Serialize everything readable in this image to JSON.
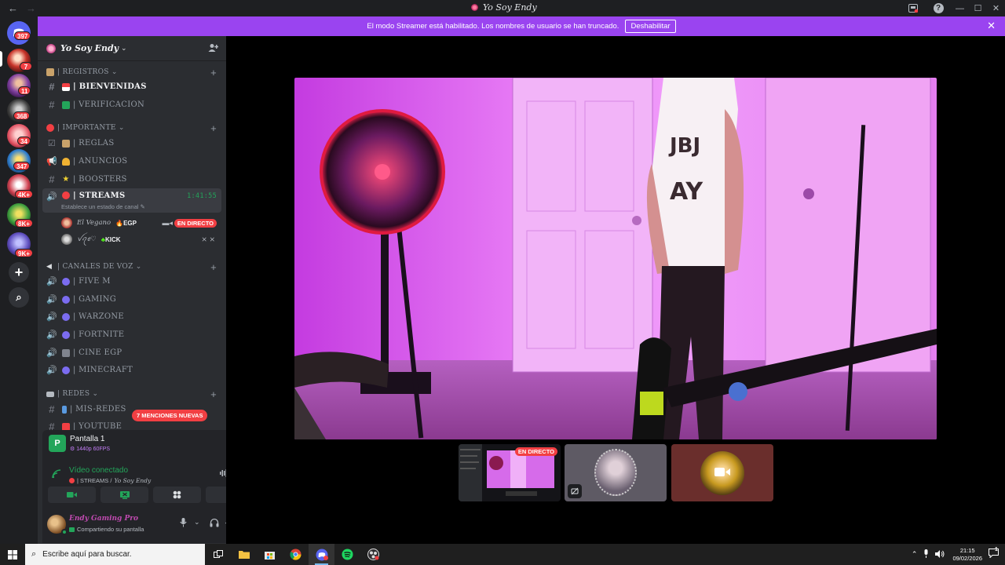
{
  "window": {
    "title": "Yo Soy Endy",
    "nav_back": "←",
    "nav_forward": "→",
    "win_minimize": "—",
    "win_maximize": "☐",
    "win_close": "✕"
  },
  "streamer_banner": {
    "text": "El modo Streamer está habilitado. Los nombres de usuario se han truncado.",
    "button": "Deshabilitar"
  },
  "rail": {
    "servers": [
      {
        "badge": "397"
      },
      {
        "badge": "7"
      },
      {
        "badge": "11"
      },
      {
        "badge": "368"
      },
      {
        "badge": "34"
      },
      {
        "badge": "347"
      },
      {
        "badge": "4K+"
      },
      {
        "badge": "8K+"
      },
      {
        "badge": "9K+"
      }
    ],
    "add_label": "+",
    "discover_label": "⌕"
  },
  "guild": {
    "name": "Yo Soy Endy"
  },
  "categories": [
    {
      "label": "| REGISTROS ⌄"
    },
    {
      "label": "| IMPORTANTE ⌄"
    },
    {
      "label": "| CANALES DE VOZ ⌄"
    },
    {
      "label": "| REDES ⌄"
    }
  ],
  "channels": {
    "registros": [
      {
        "label": "| BIENVENIDAS"
      },
      {
        "label": "| VERIFICACION"
      }
    ],
    "importante": [
      {
        "label": "| REGLAS"
      },
      {
        "label": "| ANUNCIOS"
      },
      {
        "label": "| BOOSTERS"
      }
    ],
    "streams": {
      "label": "| STREAMS",
      "timer": "1:41:55",
      "status_hint": "Establece un estado de canal"
    },
    "voice": [
      {
        "label": "| FIVE M"
      },
      {
        "label": "|  GAMING"
      },
      {
        "label": "| WARZONE"
      },
      {
        "label": "| FORTNITE"
      },
      {
        "label": "| CINE EGP"
      },
      {
        "label": "| MINECRAFT"
      }
    ],
    "redes": [
      {
        "label": "| MIS-REDES"
      },
      {
        "label": "| YOUTUBE"
      }
    ]
  },
  "voice_users": [
    {
      "name": "El Vegano",
      "tag": "EGP",
      "live": "EN DIRECTO"
    },
    {
      "name": "ꪜꪖꫀ♡",
      "tag": "KICK"
    }
  ],
  "mentions_pill": "7 MENCIONES NUEVAS",
  "screen_share": {
    "title": "Pantalla 1",
    "quality": "1440p 60FPS"
  },
  "voice_connection": {
    "title": "Vídeo conectado",
    "channel": "| STREAMS /",
    "guild": "Yo Soy Endy"
  },
  "user": {
    "name": "Endy Gaming Pro",
    "status": "Compartiendo su pantalla"
  },
  "stage": {
    "thumb_live": "EN DIRECTO"
  },
  "taskbar": {
    "search_placeholder": "Escribe aquí para buscar.",
    "time": "21:15",
    "date": "09/02/2026",
    "notif_count": "1"
  },
  "colors": {
    "accent": "#9a44f0",
    "live_red": "#f23f43",
    "online_green": "#23a55a",
    "sidebar": "#2b2d31",
    "rail": "#1e1f22"
  }
}
